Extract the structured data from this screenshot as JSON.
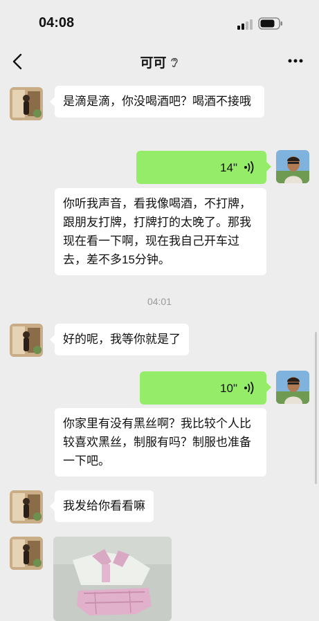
{
  "status_bar": {
    "time": "04:08",
    "signal_icon": "cellular-signal-icon",
    "battery_icon": "battery-icon"
  },
  "header": {
    "title": "可可",
    "title_icon": "ear-icon",
    "back_icon": "chevron-left-icon",
    "more_icon": "more-dots-icon"
  },
  "messages": [
    {
      "from": "contact",
      "type": "text",
      "text": "是滴是滴，你没喝酒吧？喝酒不接哦"
    },
    {
      "from": "me",
      "type": "voice",
      "duration": "14\"",
      "transcript": "你听我声音，看我像喝酒，不打牌，跟朋友打牌，打牌打的太晚了。那我现在看一下啊，现在我自己开车过去，差不多15分钟。"
    },
    {
      "from": "system",
      "type": "time",
      "text": "04:01"
    },
    {
      "from": "contact",
      "type": "text",
      "text": "好的呢，我等你就是了"
    },
    {
      "from": "me",
      "type": "voice",
      "duration": "10\"",
      "transcript": "你家里有没有黑丝啊？我比较个人比较喜欢黑丝，制服有吗？制服也准备一下吧。"
    },
    {
      "from": "contact",
      "type": "text",
      "text": "我发给你看看嘛"
    },
    {
      "from": "contact",
      "type": "image"
    }
  ],
  "colors": {
    "background": "#ededed",
    "outgoing_bubble": "#95ec69",
    "incoming_bubble": "#ffffff"
  }
}
